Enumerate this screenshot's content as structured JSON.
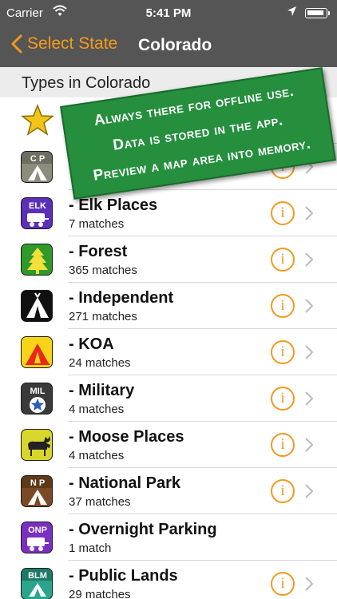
{
  "status": {
    "carrier": "Carrier",
    "time": "5:41 PM"
  },
  "nav": {
    "back_label": "Select State",
    "title": "Colorado"
  },
  "section": {
    "header": "Types in Colorado"
  },
  "banner": {
    "line1": "Always there for offline use.",
    "line2": "Data is stored in the app.",
    "line3": "Preview a map area into memory."
  },
  "rows": [
    {
      "label": "",
      "count": "",
      "icon": "favorites-star-icon"
    },
    {
      "label": "",
      "count": "",
      "icon": "campground-cp-icon"
    },
    {
      "label": "- Elk Places",
      "count": "7 matches",
      "icon": "elk-icon"
    },
    {
      "label": "- Forest",
      "count": "365 matches",
      "icon": "forest-tree-icon"
    },
    {
      "label": "- Independent",
      "count": "271 matches",
      "icon": "independent-tent-icon"
    },
    {
      "label": "- KOA",
      "count": "24 matches",
      "icon": "koa-tent-icon"
    },
    {
      "label": "- Military",
      "count": "4 matches",
      "icon": "military-icon"
    },
    {
      "label": "- Moose Places",
      "count": "4 matches",
      "icon": "moose-icon"
    },
    {
      "label": "- National Park",
      "count": "37 matches",
      "icon": "national-park-icon"
    },
    {
      "label": "- Overnight Parking",
      "count": "1 match",
      "icon": "overnight-parking-icon"
    },
    {
      "label": "- Public Lands",
      "count": "29 matches",
      "icon": "public-lands-icon"
    }
  ],
  "icon_badges": {
    "cp": "C P",
    "elk": "ELK",
    "mil": "MIL",
    "np": "N P",
    "onp": "ONP",
    "blm": "BLM"
  },
  "colors": {
    "accent": "#f09a20",
    "bar": "#555555",
    "banner": "#258f3e"
  }
}
